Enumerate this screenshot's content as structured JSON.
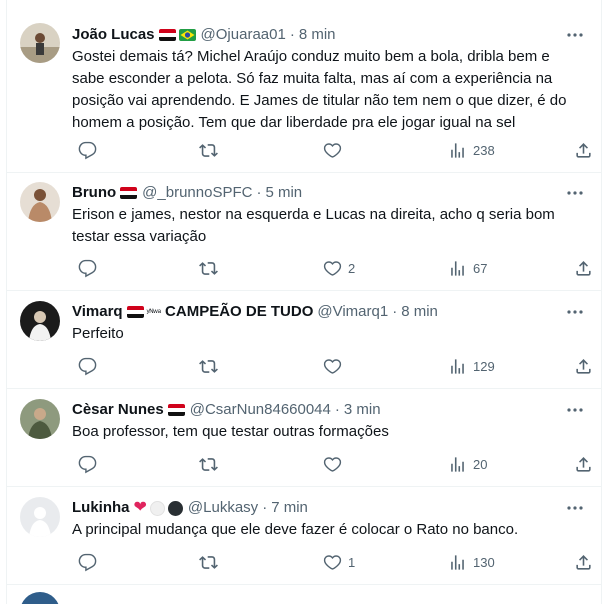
{
  "colors": {
    "text": "#0f1419",
    "secondary": "#536471",
    "border": "#eff3f4",
    "heart": "#e0245e"
  },
  "icons": [
    "more-icon",
    "reply-icon",
    "retweet-icon",
    "like-icon",
    "views-icon",
    "share-icon"
  ],
  "tweets": [
    {
      "name": "João Lucas",
      "handle": "@Ojuaraa01",
      "separator": "·",
      "time": "8 min",
      "text": "Gostei demais tá? Michel Araújo conduz muito bem a bola, dribla bem e sabe esconder a pelota. Só faz muita falta, mas aí com a experiência na posição vai aprendendo. E James de titular não tem nem o que dizer, é do homem a posição. Tem que dar liberdade pra ele jogar igual na sel",
      "replies": "",
      "retweets": "",
      "likes": "",
      "views": "238"
    },
    {
      "name": "Bruno",
      "handle": "@_brunnoSPFC",
      "separator": "·",
      "time": "5 min",
      "text": "Erison e james, nestor na esquerda e Lucas na direita, acho q seria bom testar essa variação",
      "replies": "",
      "retweets": "",
      "likes": "2",
      "views": "67"
    },
    {
      "name": "Vimarq",
      "name_sup": "ʸᴺʷᵃ",
      "name_badge": "CAMPEÃO DE TUDO",
      "handle": "@Vimarq1",
      "separator": "·",
      "time": "8 min",
      "text": "Perfeito",
      "replies": "",
      "retweets": "",
      "likes": "",
      "views": "129"
    },
    {
      "name": "Cèsar Nunes",
      "handle": "@CsarNun84660044",
      "separator": "·",
      "time": "3 min",
      "text": "Boa professor, tem que testar outras formações",
      "replies": "",
      "retweets": "",
      "likes": "",
      "views": "20"
    },
    {
      "name": "Lukinha",
      "handle": "@Lukkasy",
      "separator": "·",
      "time": "7 min",
      "text": "A principal mudança que ele deve fazer é colocar o Rato no banco.",
      "replies": "",
      "retweets": "",
      "likes": "1",
      "views": "130"
    }
  ]
}
